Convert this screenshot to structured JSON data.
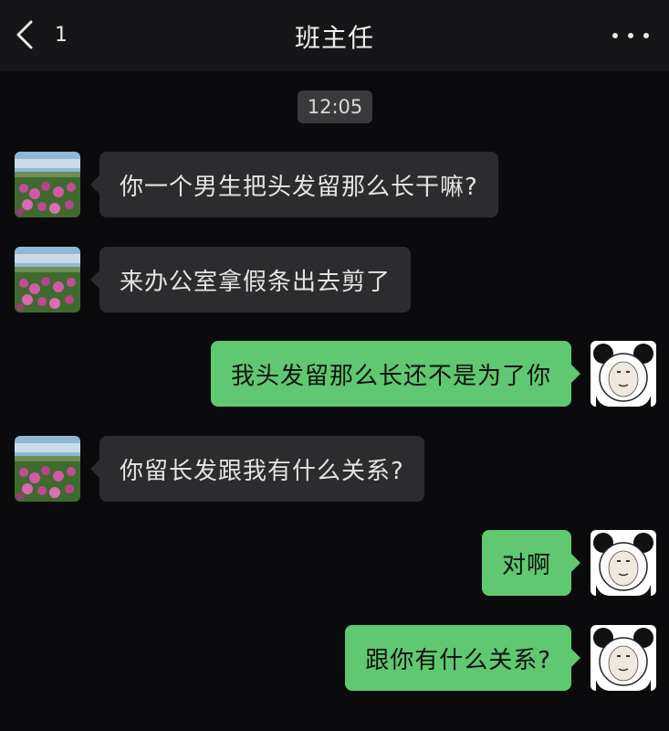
{
  "header": {
    "unread_count": "1",
    "title": "班主任"
  },
  "timestamp": "12:05",
  "messages": [
    {
      "side": "left",
      "text": "你一个男生把头发留那么长干嘛?",
      "avatar": "flower-field-avatar"
    },
    {
      "side": "left",
      "text": "来办公室拿假条出去剪了",
      "avatar": "flower-field-avatar"
    },
    {
      "side": "right",
      "text": "我头发留那么长还不是为了你",
      "avatar": "panda-meme-avatar"
    },
    {
      "side": "left",
      "text": "你留长发跟我有什么关系?",
      "avatar": "flower-field-avatar"
    },
    {
      "side": "right",
      "text": "对啊",
      "avatar": "panda-meme-avatar"
    },
    {
      "side": "right",
      "text": "跟你有什么关系?",
      "avatar": "panda-meme-avatar"
    }
  ],
  "colors": {
    "background": "#0b0b0d",
    "header": "#161618",
    "incoming_bubble": "#2c2c2e",
    "outgoing_bubble": "#5fc870"
  }
}
